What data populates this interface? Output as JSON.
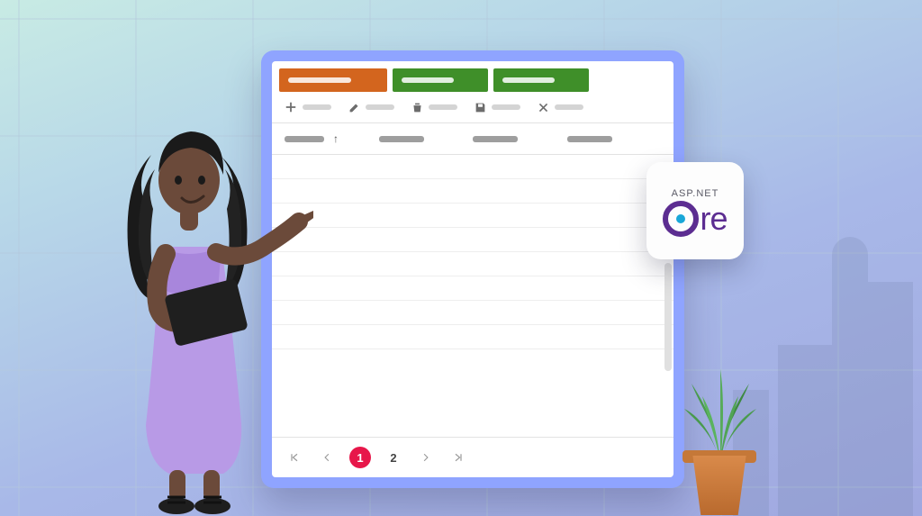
{
  "badge": {
    "top_label": "ASP.NET",
    "bottom_label": "re"
  },
  "grid": {
    "action_buttons": [
      {
        "name": "action-btn-1",
        "color": "orange"
      },
      {
        "name": "action-btn-2",
        "color": "green"
      },
      {
        "name": "action-btn-3",
        "color": "green"
      }
    ],
    "toolbar": [
      {
        "name": "add",
        "icon": "plus"
      },
      {
        "name": "edit",
        "icon": "pencil"
      },
      {
        "name": "delete",
        "icon": "trash"
      },
      {
        "name": "update",
        "icon": "save"
      },
      {
        "name": "cancel",
        "icon": "close"
      }
    ],
    "columns": 4,
    "sort_column_index": 0,
    "sort_direction": "asc",
    "row_count": 8,
    "pager": {
      "first": "|<",
      "prev": "<",
      "pages": [
        "1",
        "2"
      ],
      "current_page": "1",
      "next": ">",
      "last": ">|"
    }
  }
}
